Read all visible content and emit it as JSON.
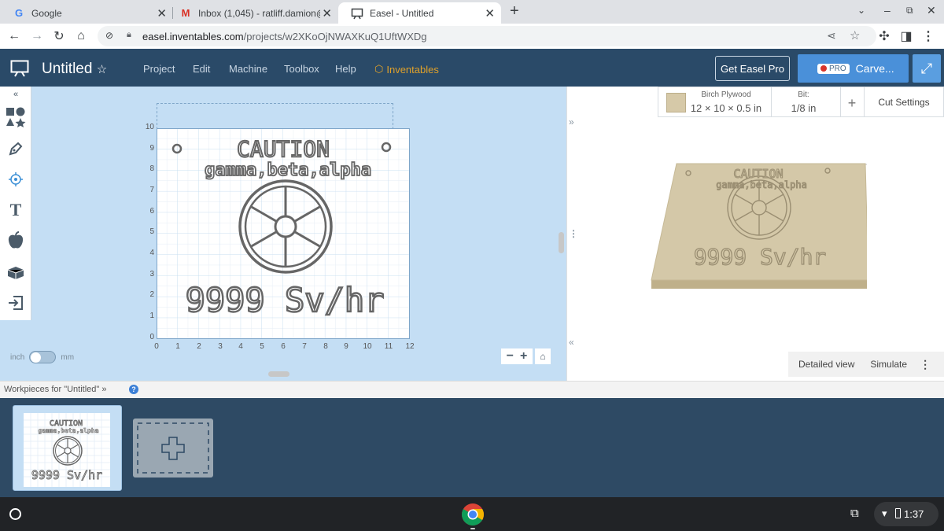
{
  "browser": {
    "tabs": [
      {
        "title": "Google",
        "icon": "google-icon"
      },
      {
        "title": "Inbox (1,045) - ratliff.damion@a",
        "icon": "gmail-icon"
      },
      {
        "title": "Easel - Untitled",
        "icon": "easel-icon",
        "active": true
      }
    ],
    "new_tab": "+",
    "url_host": "easel.inventables.com",
    "url_path": "/projects/w2XKoOjNWAXKuQ1UftWXDg"
  },
  "app": {
    "title": "Untitled",
    "star": "☆",
    "menu": [
      "Project",
      "Edit",
      "Machine",
      "Toolbox",
      "Help"
    ],
    "inventables": "Inventables",
    "get_pro": "Get Easel Pro",
    "pro_badge": "PRO",
    "carve": "Carve..."
  },
  "canvas": {
    "y_ticks": [
      "10",
      "9",
      "8",
      "7",
      "6",
      "5",
      "4",
      "3",
      "2",
      "1",
      "0"
    ],
    "x_ticks": [
      "0",
      "1",
      "2",
      "3",
      "4",
      "5",
      "6",
      "7",
      "8",
      "9",
      "10",
      "11",
      "12"
    ],
    "design_line1": "CAUTION",
    "design_line2": "gamma,beta,alpha",
    "design_line3": "9999 Sv/hr",
    "unit_inch": "inch",
    "unit_mm": "mm"
  },
  "material": {
    "name": "Birch Plywood",
    "size": "12 × 10 × 0.5 in",
    "bit_label": "Bit:",
    "bit_value": "1/8 in",
    "add": "+",
    "cut_settings": "Cut Settings"
  },
  "preview": {
    "detailed": "Detailed view",
    "simulate": "Simulate"
  },
  "workpieces": {
    "title": "Workpieces for \"Untitled\""
  },
  "shelf": {
    "time": "1:37"
  }
}
